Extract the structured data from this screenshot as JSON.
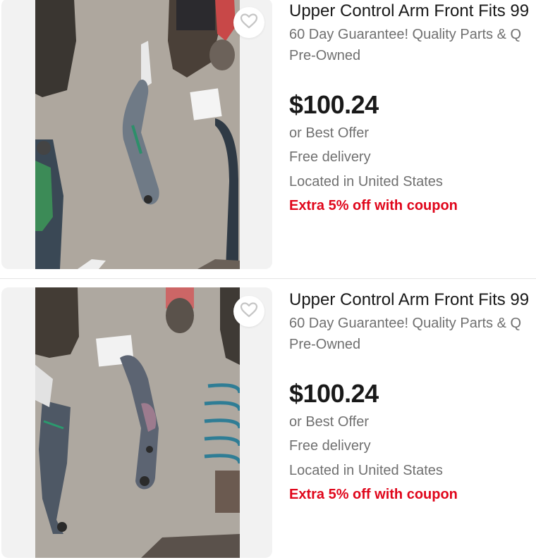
{
  "listings": [
    {
      "title": "Upper Control Arm Front Fits 99",
      "subtitle": "60 Day Guarantee! Quality Parts & Q",
      "condition": "Pre-Owned",
      "price": "$100.24",
      "offer": "or Best Offer",
      "delivery": "Free delivery",
      "location": "Located in United States",
      "coupon": "Extra 5% off with coupon"
    },
    {
      "title": "Upper Control Arm Front Fits 99",
      "subtitle": "60 Day Guarantee! Quality Parts & Q",
      "condition": "Pre-Owned",
      "price": "$100.24",
      "offer": "or Best Offer",
      "delivery": "Free delivery",
      "location": "Located in United States",
      "coupon": "Extra 5% off with coupon"
    }
  ],
  "icons": {
    "watch": "heart-outline-icon"
  },
  "colors": {
    "coupon": "#e0061b",
    "secondary_text": "#707070",
    "primary_text": "#191919",
    "image_bg": "#f2f2f2"
  }
}
